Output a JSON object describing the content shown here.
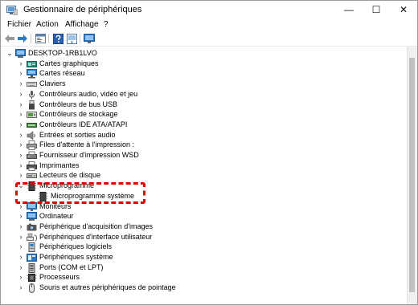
{
  "window": {
    "title": "Gestionnaire de périphériques",
    "minimize_glyph": "—",
    "maximize_glyph": "☐",
    "close_glyph": "✕"
  },
  "menu": [
    "Fichier",
    "Action",
    "Affichage",
    "?"
  ],
  "toolbar": [
    "back-icon",
    "forward-icon",
    "properties-icon",
    "help-icon",
    "update-icon",
    "monitor-icon"
  ],
  "tree": {
    "root": "DESKTOP-1RB1LVO",
    "items": [
      {
        "label": "Cartes graphiques",
        "icon": "display-adapter-icon"
      },
      {
        "label": "Cartes réseau",
        "icon": "network-adapter-icon"
      },
      {
        "label": "Claviers",
        "icon": "keyboard-icon"
      },
      {
        "label": "Contrôleurs audio, vidéo et jeu",
        "icon": "audio-icon"
      },
      {
        "label": "Contrôleurs de bus USB",
        "icon": "usb-icon"
      },
      {
        "label": "Contrôleurs de stockage",
        "icon": "storage-controller-icon"
      },
      {
        "label": "Contrôleurs IDE ATA/ATAPI",
        "icon": "ide-icon"
      },
      {
        "label": "Entrées et sorties audio",
        "icon": "speaker-icon"
      },
      {
        "label": "Files d'attente à l'impression :",
        "icon": "print-queue-icon"
      },
      {
        "label": "Fournisseur d'impression WSD",
        "icon": "wsd-icon"
      },
      {
        "label": "Imprimantes",
        "icon": "printer-icon"
      },
      {
        "label": "Lecteurs de disque",
        "icon": "disk-drive-icon"
      },
      {
        "label": "Microprogramme",
        "icon": "firmware-icon",
        "expanded": true,
        "children": [
          {
            "label": "Microprogramme système",
            "icon": "firmware-icon"
          }
        ]
      },
      {
        "label": "Moniteurs",
        "icon": "monitor-icon"
      },
      {
        "label": "Ordinateur",
        "icon": "computer-icon"
      },
      {
        "label": "Périphérique d'acquisition d'images",
        "icon": "camera-icon"
      },
      {
        "label": "Périphériques d'interface utilisateur",
        "icon": "hid-icon"
      },
      {
        "label": "Périphériques logiciels",
        "icon": "software-device-icon"
      },
      {
        "label": "Périphériques système",
        "icon": "system-device-icon"
      },
      {
        "label": "Ports (COM et LPT)",
        "icon": "port-icon"
      },
      {
        "label": "Processeurs",
        "icon": "processor-icon"
      },
      {
        "label": "Souris et autres périphériques de pointage",
        "icon": "mouse-icon"
      }
    ]
  },
  "colors": {
    "highlight": "#e00000",
    "accent_blue": "#2a78c8"
  }
}
